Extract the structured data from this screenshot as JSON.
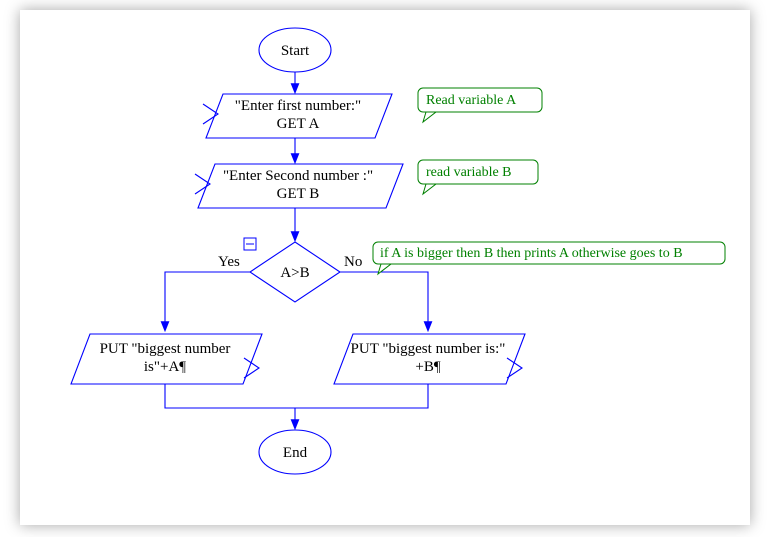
{
  "start": {
    "label": "Start"
  },
  "inputA": {
    "line1": "\"Enter first number:\"",
    "line2": "GET A"
  },
  "inputB": {
    "line1": "\"Enter Second number :\"",
    "line2": "GET B"
  },
  "decision": {
    "condition": "A>B",
    "yes": "Yes",
    "no": "No"
  },
  "outA": {
    "line1": "PUT \"biggest number",
    "line2": "is\"+A¶"
  },
  "outB": {
    "line1": "PUT \"biggest number is:\"",
    "line2": "+B¶"
  },
  "end": {
    "label": "End"
  },
  "callouts": {
    "c1": "Read variable A",
    "c2": "read variable B",
    "c3": "if A is bigger then B then prints A otherwise goes to B"
  }
}
